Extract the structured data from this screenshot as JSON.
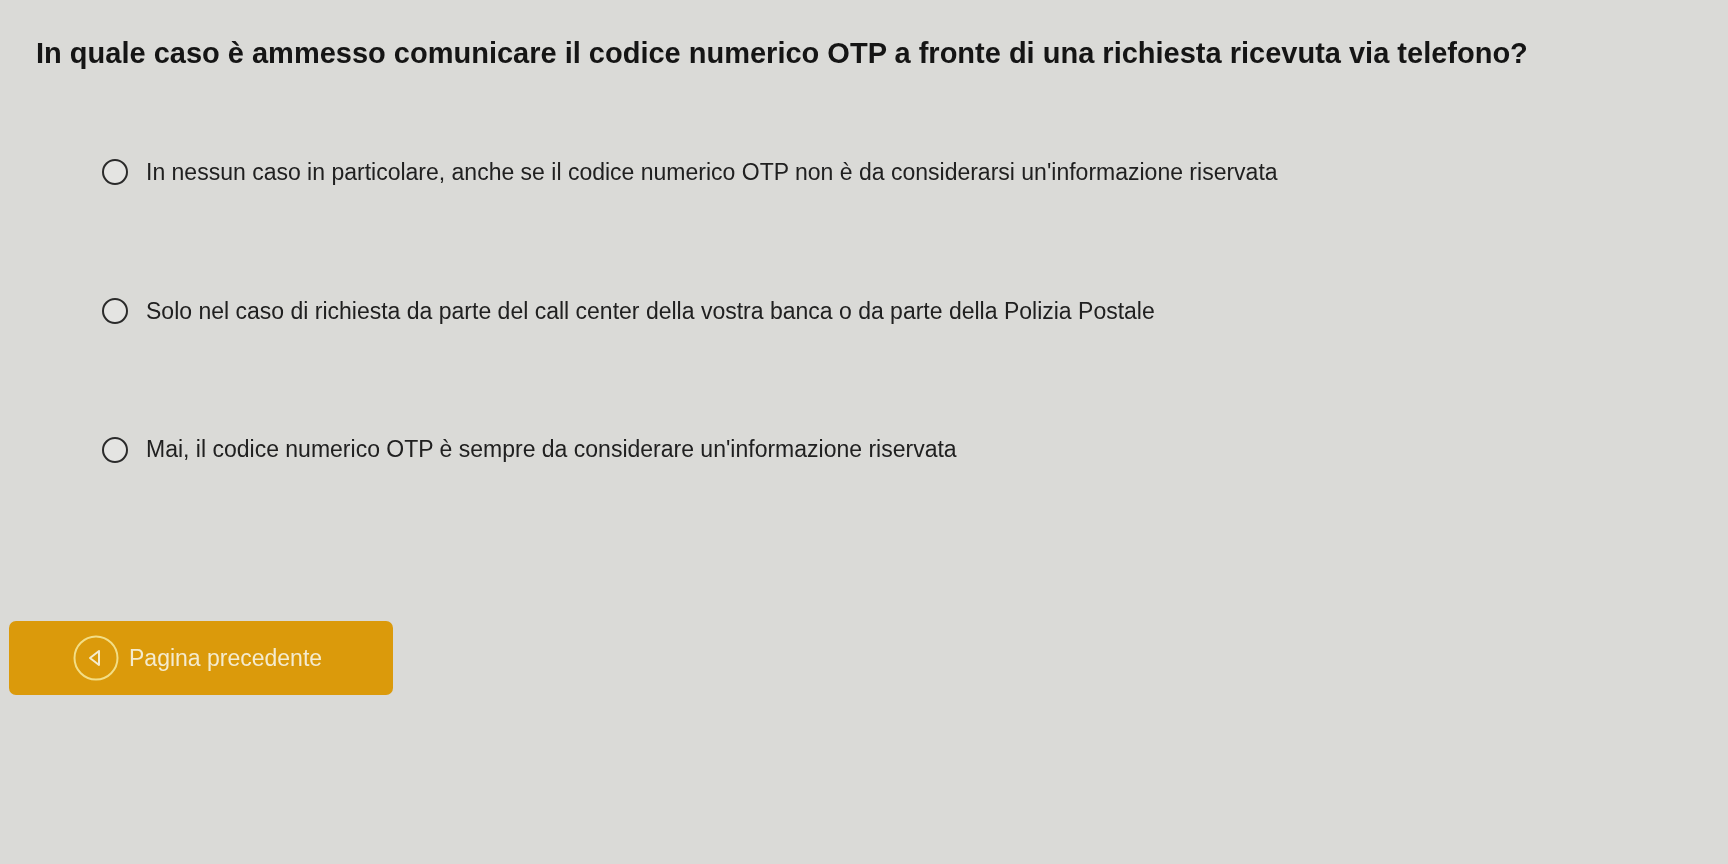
{
  "question": {
    "text": "In quale caso è ammesso comunicare il codice numerico OTP a fronte di una richiesta ricevuta via telefono?"
  },
  "options": [
    {
      "label": "In nessun caso in particolare, anche se il codice numerico OTP non è da considerarsi un'informazione riservata",
      "selected": false
    },
    {
      "label": "Solo nel caso di richiesta da parte del call center della vostra banca o da parte della Polizia Postale",
      "selected": false
    },
    {
      "label": "Mai, il codice numerico OTP è sempre da considerare un'informazione riservata",
      "selected": false
    }
  ],
  "buttons": [
    {
      "label": "Pagina precedente",
      "kind": "previous"
    }
  ]
}
